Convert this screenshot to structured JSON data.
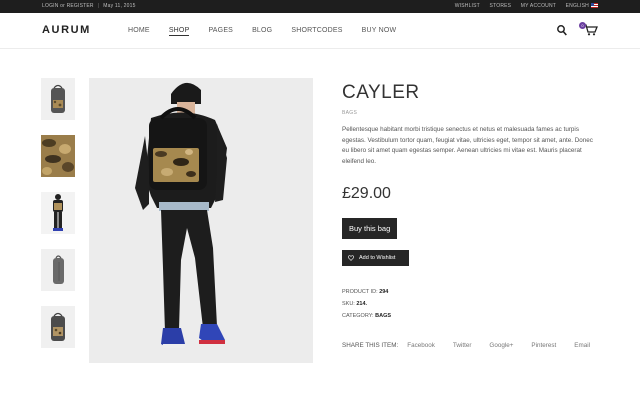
{
  "topbar": {
    "account_text": "LOGIN or REGISTER",
    "date": "May 11, 2015",
    "links": [
      "WISHLIST",
      "STORES",
      "MY ACCOUNT",
      "ENGLISH"
    ]
  },
  "header": {
    "logo": "AURUM",
    "nav": [
      "HOME",
      "SHOP",
      "PAGES",
      "BLOG",
      "SHORTCODES",
      "BUY NOW"
    ],
    "active_nav": "SHOP",
    "cart_count": "0",
    "icons": [
      "search-icon",
      "cart-icon"
    ]
  },
  "product": {
    "title": "CAYLER",
    "category_label": "BAGS",
    "description": "Pellentesque habitant morbi tristique senectus et netus et malesuada fames ac turpis egestas. Vestibulum tortor quam, feugiat vitae, ultricies eget, tempor sit amet, ante. Donec eu libero sit amet quam egestas semper. Aenean ultricies mi vitae est. Mauris placerat eleifend leo.",
    "price": "£29.00",
    "buy_label": "Buy this bag",
    "wishlist_label": "Add to Wishlist",
    "meta": {
      "id_label": "PRODUCT ID:",
      "id_value": "294",
      "sku_label": "SKU:",
      "sku_value": "214.",
      "category_label": "CATEGORY:",
      "category_value": "BAGS"
    },
    "share": {
      "label": "SHARE THIS ITEM:",
      "links": [
        "Facebook",
        "Twitter",
        "Google+",
        "Pinterest",
        "Email"
      ]
    }
  },
  "colors": {
    "topbar_bg": "#1e1e1e",
    "button_bg": "#262626",
    "badge": "#6b3fa0"
  }
}
